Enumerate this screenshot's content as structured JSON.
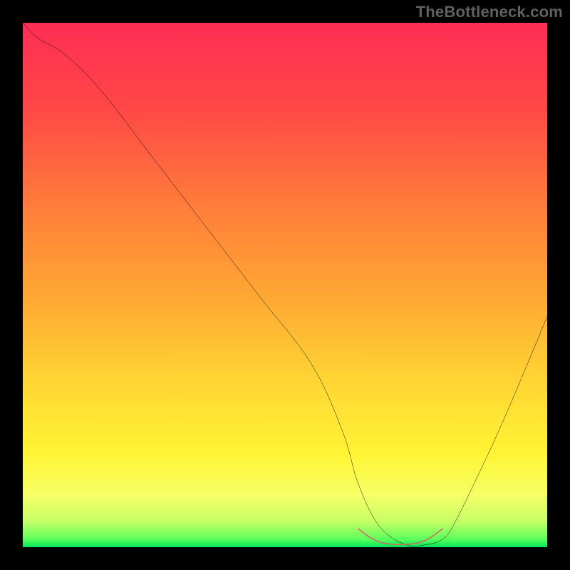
{
  "watermark": "TheBottleneck.com",
  "chart_data": {
    "type": "line",
    "title": "",
    "xlabel": "",
    "ylabel": "",
    "xlim": [
      0,
      100
    ],
    "ylim": [
      0,
      100
    ],
    "series": [
      {
        "name": "bottleneck-curve",
        "x": [
          0,
          3,
          8,
          15,
          25,
          35,
          45,
          55,
          61,
          64,
          68,
          73,
          77,
          80,
          82,
          86,
          92,
          100
        ],
        "y": [
          100,
          97,
          94,
          87,
          74,
          61,
          48,
          35,
          22,
          12,
          4,
          0.5,
          0.5,
          1.5,
          4,
          12,
          25,
          44
        ]
      }
    ],
    "highlight": {
      "name": "optimal-range",
      "x": [
        64,
        66,
        68,
        70,
        72,
        74,
        76,
        78,
        80
      ],
      "y": [
        3.5,
        2.0,
        1.0,
        0.6,
        0.5,
        0.6,
        1.0,
        2.0,
        3.5
      ],
      "color": "#d26a63"
    },
    "gradient_stops": [
      {
        "offset": 0.0,
        "color": "#ff2d55"
      },
      {
        "offset": 0.16,
        "color": "#ff4747"
      },
      {
        "offset": 0.34,
        "color": "#ff7a3a"
      },
      {
        "offset": 0.52,
        "color": "#ffa733"
      },
      {
        "offset": 0.68,
        "color": "#ffd433"
      },
      {
        "offset": 0.82,
        "color": "#fff433"
      },
      {
        "offset": 0.9,
        "color": "#f7ff66"
      },
      {
        "offset": 0.95,
        "color": "#c8ff66"
      },
      {
        "offset": 0.985,
        "color": "#5bff5b"
      },
      {
        "offset": 1.0,
        "color": "#00e65c"
      }
    ]
  }
}
